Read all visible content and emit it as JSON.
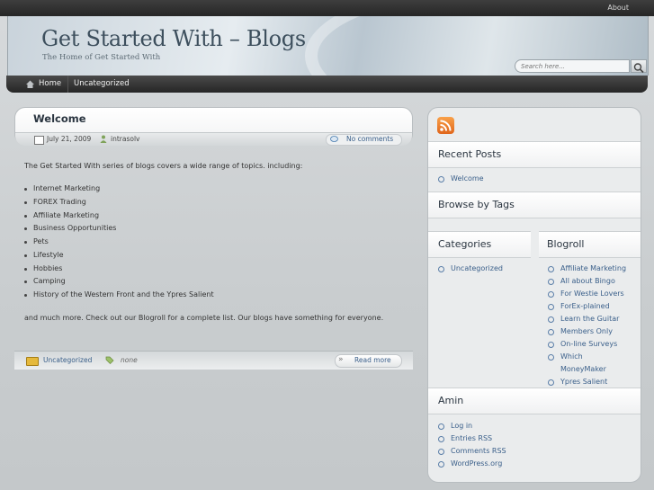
{
  "topbar": {
    "about_label": "About"
  },
  "header": {
    "title": "Get Started With – Blogs",
    "description": "The Home of Get Started With"
  },
  "search": {
    "placeholder": "Search here..."
  },
  "nav": {
    "items": [
      {
        "label": "Home"
      },
      {
        "label": "Uncategorized"
      }
    ]
  },
  "post": {
    "title": "Welcome",
    "date": "July 21, 2009",
    "author": "intrasolv",
    "comments_label": "No comments",
    "intro": "The Get Started With series of blogs covers a wide range of topics. including:",
    "topics": [
      "Internet Marketing",
      "FOREX Trading",
      "Affiliate Marketing",
      "Business Opportunities",
      "Pets",
      "Lifestyle",
      "Hobbies",
      "Camping",
      "History of the Western Front and the Ypres Salient"
    ],
    "outro": "and much more. Check out  our Blogroll for a complete list. Our blogs have something for everyone.",
    "category": "Uncategorized",
    "tags": "none",
    "read_more": "Read more"
  },
  "sidebar": {
    "recent_posts": {
      "title": "Recent Posts",
      "items": [
        "Welcome"
      ]
    },
    "browse_by_tags": {
      "title": "Browse by Tags"
    },
    "categories": {
      "title": "Categories",
      "items": [
        "Uncategorized"
      ]
    },
    "blogroll": {
      "title": "Blogroll",
      "items": [
        "Affiliate Marketing",
        "All about Bingo",
        "For Westie Lovers",
        "ForEx-plained",
        "Learn the Guitar",
        "Members Only",
        "On-line Surveys",
        "Which",
        "MoneyMaker",
        "Ypres Salient"
      ]
    },
    "admin": {
      "title": "Amin",
      "items": [
        "Log in",
        "Entries RSS",
        "Comments RSS",
        "WordPress.org"
      ]
    }
  },
  "colors": {
    "header_title": "#3d4f5d",
    "link": "#3a5f8a",
    "rss": "#e0651a"
  }
}
